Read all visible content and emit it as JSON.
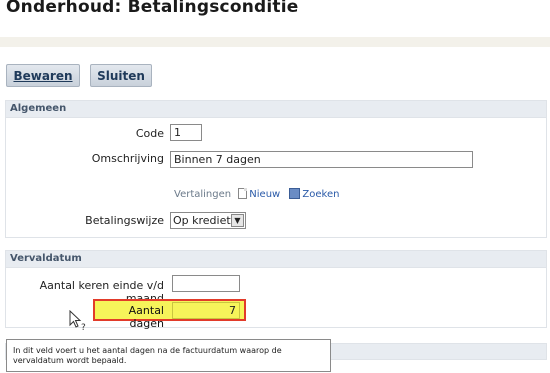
{
  "page": {
    "title": "Onderhoud: Betalingsconditie"
  },
  "toolbar": {
    "save_label": "Bewaren",
    "close_label": "Sluiten"
  },
  "general": {
    "header": "Algemeen",
    "code_label": "Code",
    "code_value": "1",
    "description_label": "Omschrijving",
    "description_value": "Binnen 7 dagen",
    "translations_label": "Vertalingen",
    "new_link": "Nieuw",
    "search_link": "Zoeken",
    "payment_method_label": "Betalingswijze",
    "payment_method_value": "Op krediet"
  },
  "due_date": {
    "header": "Vervaldatum",
    "month_end_label": "Aantal keren einde v/d maand",
    "month_end_value": "",
    "days_label": "Aantal dagen",
    "days_value": "7"
  },
  "tooltip": {
    "line1": "In dit veld voert u het aantal dagen na de factuurdatum waarop de",
    "line2": "vervaldatum wordt bepaald."
  },
  "icons": [
    "document-icon",
    "search-icon",
    "dropdown-arrow-icon",
    "mouse-pointer-icon"
  ],
  "colors": {
    "highlight_fill": "#f6f45a",
    "highlight_border": "#e23b2a",
    "header_bg": "#e8ecf1"
  }
}
